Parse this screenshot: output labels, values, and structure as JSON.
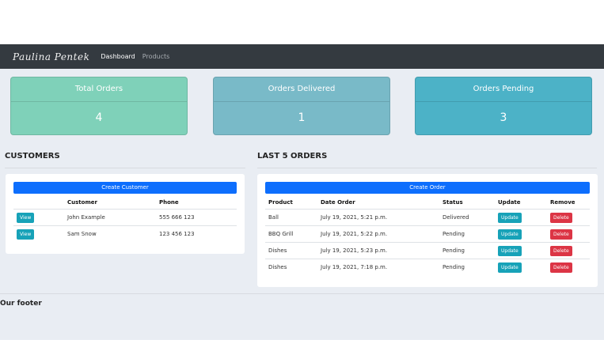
{
  "navbar": {
    "brand": "Paulina Pentek",
    "links": [
      "Dashboard",
      "Products"
    ]
  },
  "stats": [
    {
      "title": "Total Orders",
      "value": "4",
      "color": "#7fd1b9"
    },
    {
      "title": "Orders Delivered",
      "value": "1",
      "color": "#79bac8"
    },
    {
      "title": "Orders Pending",
      "value": "3",
      "color": "#4cb2c7"
    }
  ],
  "customers": {
    "title": "CUSTOMERS",
    "create_label": "Create Customer",
    "headers": [
      "",
      "Customer",
      "Phone"
    ],
    "rows": [
      {
        "button": "View",
        "name": "John Example",
        "phone": "555 666 123"
      },
      {
        "button": "View",
        "name": "Sam Snow",
        "phone": "123 456 123"
      }
    ]
  },
  "orders": {
    "title": "LAST 5 ORDERS",
    "create_label": "Create Order",
    "headers": [
      "Product",
      "Date Order",
      "Status",
      "Update",
      "Remove"
    ],
    "rows": [
      {
        "product": "Ball",
        "date": "July 19, 2021, 5:21 p.m.",
        "status": "Delivered",
        "update": "Update",
        "remove": "Delete"
      },
      {
        "product": "BBQ Grill",
        "date": "July 19, 2021, 5:22 p.m.",
        "status": "Pending",
        "update": "Update",
        "remove": "Delete"
      },
      {
        "product": "Dishes",
        "date": "July 19, 2021, 5:23 p.m.",
        "status": "Pending",
        "update": "Update",
        "remove": "Delete"
      },
      {
        "product": "Dishes",
        "date": "July 19, 2021, 7:18 p.m.",
        "status": "Pending",
        "update": "Update",
        "remove": "Delete"
      }
    ]
  },
  "footer": {
    "text": "Our footer"
  }
}
